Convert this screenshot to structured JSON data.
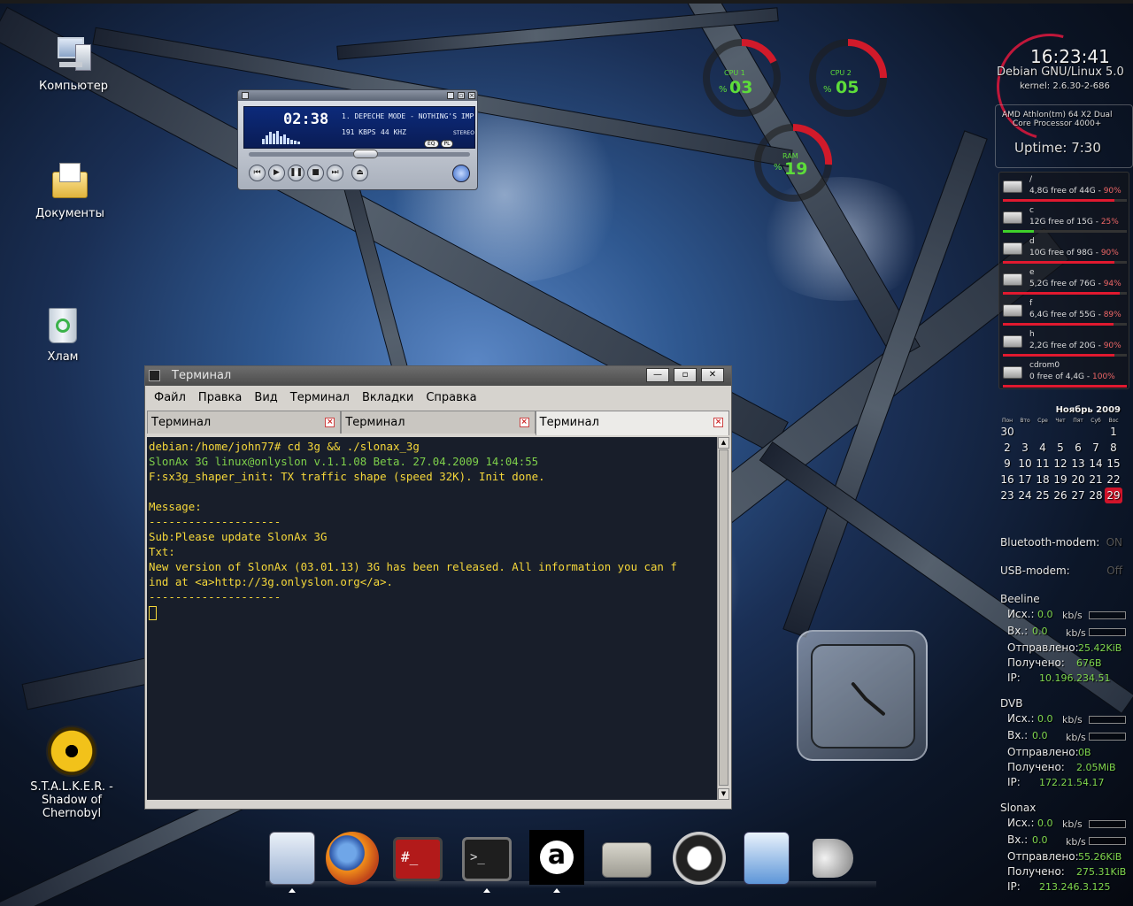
{
  "desktop": {
    "icons": [
      {
        "label": "Компьютер"
      },
      {
        "label": "Документы"
      },
      {
        "label": "Хлам"
      },
      {
        "label": "S.T.A.L.K.E.R. -\nShadow of Chernobyl"
      }
    ]
  },
  "winamp": {
    "time": "02:38",
    "track": "1. DEPECHE MODE - NOTHING'S IMP",
    "kbps": "191 KBPS",
    "khz": "44 KHZ",
    "stereo": "STEREO",
    "eq_label": "EQ",
    "pl_label": "PL"
  },
  "gauges": {
    "cpu1": {
      "label": "CPU 1",
      "value": "03",
      "pct": "%"
    },
    "cpu2": {
      "label": "CPU 2",
      "value": "05",
      "pct": "%"
    },
    "ram": {
      "label": "RAM",
      "value": "19",
      "pct": "%"
    }
  },
  "sysinfo": {
    "clock": "16:23:41",
    "os": "Debian GNU/Linux 5.0",
    "kernel": "kernel: 2.6.30-2-686",
    "cpu_line1": "AMD Athlon(tm) 64 X2 Dual",
    "cpu_line2": "Core Processor 4000+",
    "uptime": "Uptime: 7:30"
  },
  "disks": [
    {
      "name": "/",
      "info": "4,8G free of 44G - ",
      "pct": "90%",
      "used": 0.9,
      "color": "#e1192f"
    },
    {
      "name": "c",
      "info": "12G free of 15G - ",
      "pct": "25%",
      "used": 0.25,
      "color": "#3fd12a"
    },
    {
      "name": "d",
      "info": "10G free of 98G - ",
      "pct": "90%",
      "used": 0.9,
      "color": "#e1192f"
    },
    {
      "name": "e",
      "info": "5,2G free of 76G - ",
      "pct": "94%",
      "used": 0.94,
      "color": "#e1192f"
    },
    {
      "name": "f",
      "info": "6,4G free of 55G - ",
      "pct": "89%",
      "used": 0.89,
      "color": "#e1192f"
    },
    {
      "name": "h",
      "info": "2,2G free of 20G - ",
      "pct": "90%",
      "used": 0.9,
      "color": "#e1192f"
    },
    {
      "name": "cdrom0",
      "info": "0 free of 4,4G - ",
      "pct": "100%",
      "used": 1.0,
      "color": "#e1192f"
    }
  ],
  "calendar": {
    "month": "Ноябрь 2009",
    "dows": [
      "Пон",
      "Втo",
      "Сре",
      "Чет",
      "Пят",
      "Суб",
      "Вос"
    ],
    "days": [
      "30",
      "",
      "",
      "",
      "",
      "",
      "1",
      "2",
      "3",
      "4",
      "5",
      "6",
      "7",
      "8",
      "9",
      "10",
      "11",
      "12",
      "13",
      "14",
      "15",
      "16",
      "17",
      "18",
      "19",
      "20",
      "21",
      "22",
      "23",
      "24",
      "25",
      "26",
      "27",
      "28",
      "29"
    ],
    "today": "29"
  },
  "status": {
    "bluetooth": {
      "label": "Bluetooth-modem:",
      "state": "ON"
    },
    "usb": {
      "label": "USB-modem:",
      "state": "Off"
    }
  },
  "networks": [
    {
      "name": "Beeline",
      "out_label": "Исх.:",
      "out": "0.0",
      "in_label": "Вх.:",
      "in": "0.0",
      "unit": "kb/s",
      "sent_label": "Отправлено:",
      "sent": "25.42KiB",
      "recv_label": "Получено:",
      "recv": "676B",
      "ip_label": "IP:",
      "ip": "10.196.234.51"
    },
    {
      "name": "DVB",
      "out_label": "Исх.:",
      "out": "0.0",
      "in_label": "Вх.:",
      "in": "0.0",
      "unit": "kb/s",
      "sent_label": "Отправлено:",
      "sent": "0B",
      "recv_label": "Получено:",
      "recv": "2.05MiB",
      "ip_label": "IP:",
      "ip": "172.21.54.17"
    },
    {
      "name": "Slonax",
      "out_label": "Исх.:",
      "out": "0.0",
      "in_label": "Вх.:",
      "in": "0.0",
      "unit": "kb/s",
      "sent_label": "Отправлено:",
      "sent": "55.26KiB",
      "recv_label": "Получено:",
      "recv": "275.31KiB",
      "ip_label": "IP:",
      "ip": "213.246.3.125"
    }
  ],
  "terminal": {
    "title": "Терминал",
    "menu": [
      "Файл",
      "Правка",
      "Вид",
      "Терминал",
      "Вкладки",
      "Справка"
    ],
    "tabs": [
      "Терминал",
      "Терминал",
      "Терминал"
    ],
    "lines": [
      {
        "text": "debian:/home/john77# cd 3g && ./slonax_3g",
        "color": "yellow"
      },
      {
        "text": "SlonAx 3G linux@onlyslon v.1.1.08 Beta. 27.04.2009 14:04:55",
        "color": "green"
      },
      {
        "text": "F:sx3g_shaper_init: TX traffic shape (speed 32K). Init done.",
        "color": "yellow"
      },
      {
        "text": "",
        "color": "yellow"
      },
      {
        "text": "Message:",
        "color": "yellow"
      },
      {
        "text": "--------------------",
        "color": "yellow"
      },
      {
        "text": "Sub:Please update SlonAx 3G",
        "color": "yellow"
      },
      {
        "text": "Txt:",
        "color": "yellow"
      },
      {
        "text": "New version of SlonAx (03.01.13) 3G has been released. All information you can f",
        "color": "yellow"
      },
      {
        "text": "ind at <a>http://3g.onlyslon.org</a>.",
        "color": "yellow"
      },
      {
        "text": "--------------------",
        "color": "yellow"
      }
    ]
  },
  "dock": {
    "items": [
      "dock-manager-icon",
      "firefox-icon",
      "root-terminal-icon",
      "terminal-icon",
      "amarok-icon",
      "folder-icon",
      "shutdown-icon",
      "text-editor-icon",
      "speaker-icon"
    ]
  }
}
